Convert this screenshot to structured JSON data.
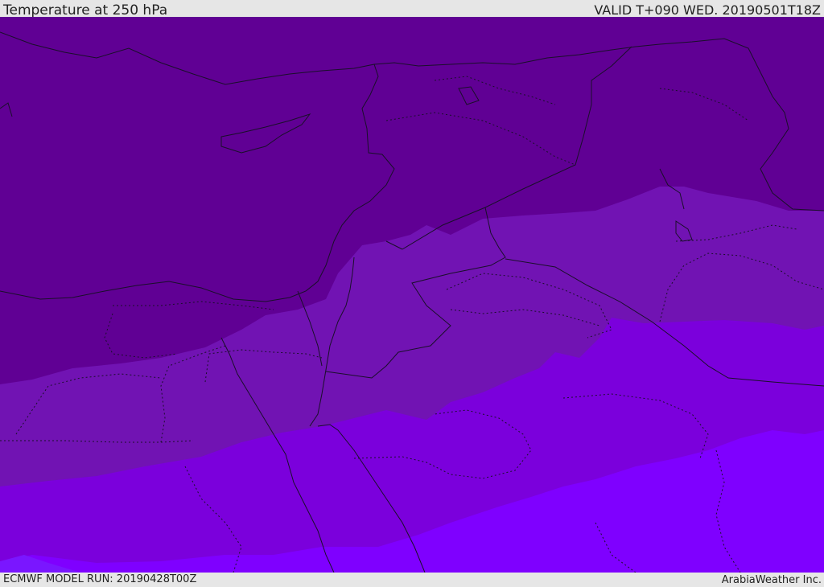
{
  "header": {
    "title": "Temperature at 250 hPa",
    "valid_time": "VALID T+090 WED. 20190501T18Z"
  },
  "footer": {
    "model_run": "ECMWF MODEL RUN: 20190428T00Z",
    "credit": "ArabiaWeather Inc."
  },
  "colors": {
    "band_coldest": "#600094",
    "band_cold": "#7113b3",
    "band_mid": "#7b00dc",
    "band_warm": "#7f00ff",
    "band_warmest": "#7a16ff",
    "border_line": "#1a0f2a",
    "bar_background": "#e6e6e6"
  }
}
